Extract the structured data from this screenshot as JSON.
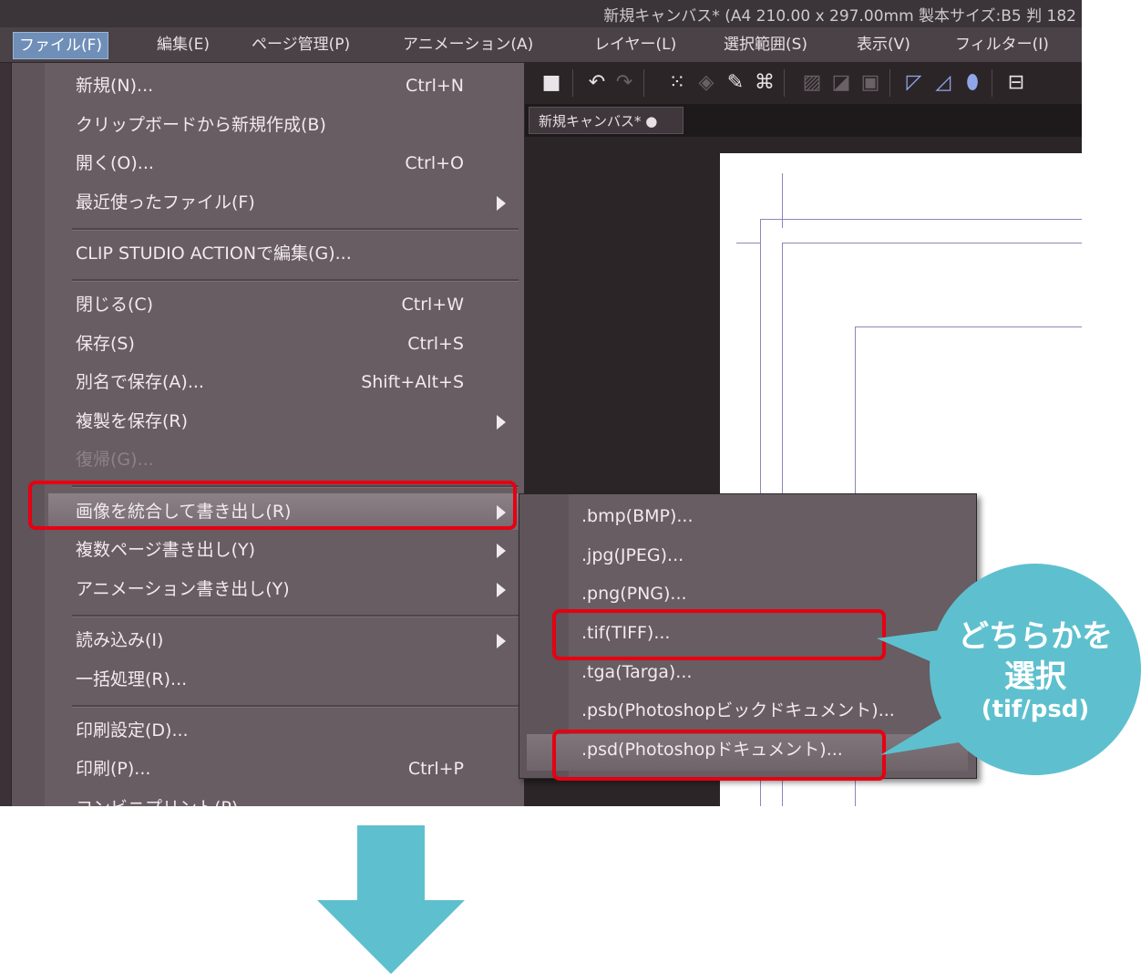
{
  "window": {
    "title": "新規キャンバス* (A4 210.00 x 297.00mm 製本サイズ:B5 判 182"
  },
  "menubar": {
    "items": [
      "ファイル(F)",
      "編集(E)",
      "ページ管理(P)",
      "アニメーション(A)",
      "レイヤー(L)",
      "選択範囲(S)",
      "表示(V)",
      "フィルター(I)"
    ]
  },
  "tab": {
    "label": "新規キャンバス* ●"
  },
  "file_menu": {
    "items": [
      {
        "label": "新規(N)...",
        "shortcut": "Ctrl+N"
      },
      {
        "label": "クリップボードから新規作成(B)",
        "shortcut": ""
      },
      {
        "label": "開く(O)...",
        "shortcut": "Ctrl+O"
      },
      {
        "label": "最近使ったファイル(F)",
        "shortcut": ""
      },
      {
        "label": "CLIP STUDIO ACTIONで編集(G)...",
        "shortcut": ""
      },
      {
        "label": "閉じる(C)",
        "shortcut": "Ctrl+W"
      },
      {
        "label": "保存(S)",
        "shortcut": "Ctrl+S"
      },
      {
        "label": "別名で保存(A)...",
        "shortcut": "Shift+Alt+S"
      },
      {
        "label": "複製を保存(R)",
        "shortcut": ""
      },
      {
        "label": "復帰(G)...",
        "shortcut": ""
      },
      {
        "label": "画像を統合して書き出し(R)",
        "shortcut": ""
      },
      {
        "label": "複数ページ書き出し(Y)",
        "shortcut": ""
      },
      {
        "label": "アニメーション書き出し(Y)",
        "shortcut": ""
      },
      {
        "label": "読み込み(I)",
        "shortcut": ""
      },
      {
        "label": "一括処理(R)...",
        "shortcut": ""
      },
      {
        "label": "印刷設定(D)...",
        "shortcut": ""
      },
      {
        "label": "印刷(P)...",
        "shortcut": "Ctrl+P"
      },
      {
        "label": "コンビニプリント(P)",
        "shortcut": ""
      }
    ]
  },
  "export_submenu": {
    "items": [
      ".bmp(BMP)...",
      ".jpg(JPEG)...",
      ".png(PNG)...",
      ".tif(TIFF)...",
      ".tga(Targa)...",
      ".psb(Photoshopビックドキュメント)...",
      ".psd(Photoshopドキュメント)..."
    ]
  },
  "callout": {
    "line1": "どちらかを",
    "line2": "選択",
    "line3": "(tif/psd)"
  },
  "colors": {
    "highlight_red": "#e60012",
    "balloon": "#5ec0ce",
    "menu_bg": "#675d62"
  }
}
